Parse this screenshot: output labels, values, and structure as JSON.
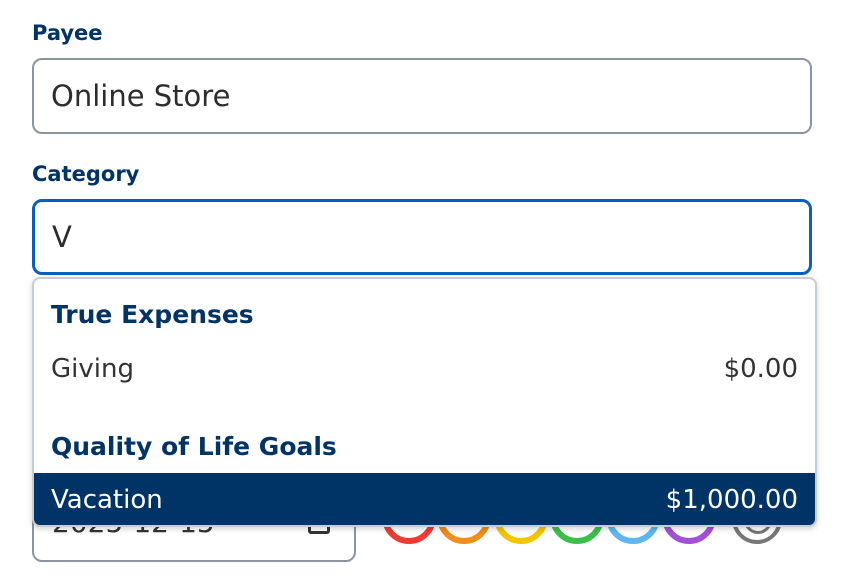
{
  "payee": {
    "label": "Payee",
    "value": "Online Store"
  },
  "category": {
    "label": "Category",
    "value": "V"
  },
  "dropdown": {
    "groups": [
      {
        "heading": "True Expenses",
        "options": [
          {
            "name": "Giving",
            "amount": "$0.00",
            "selected": false
          }
        ]
      },
      {
        "heading": "Quality of Life Goals",
        "options": [
          {
            "name": "Vacation",
            "amount": "$1,000.00",
            "selected": true
          }
        ]
      }
    ]
  },
  "date_field": {
    "value": "2025-12-15"
  },
  "colors": {
    "accent": "#003366",
    "focus_border": "#0a5ec2",
    "flag_colors": [
      "#ee3b33",
      "#f28c1a",
      "#f5c400",
      "#3cbf4a",
      "#5fb6f0",
      "#a34fd6"
    ]
  }
}
